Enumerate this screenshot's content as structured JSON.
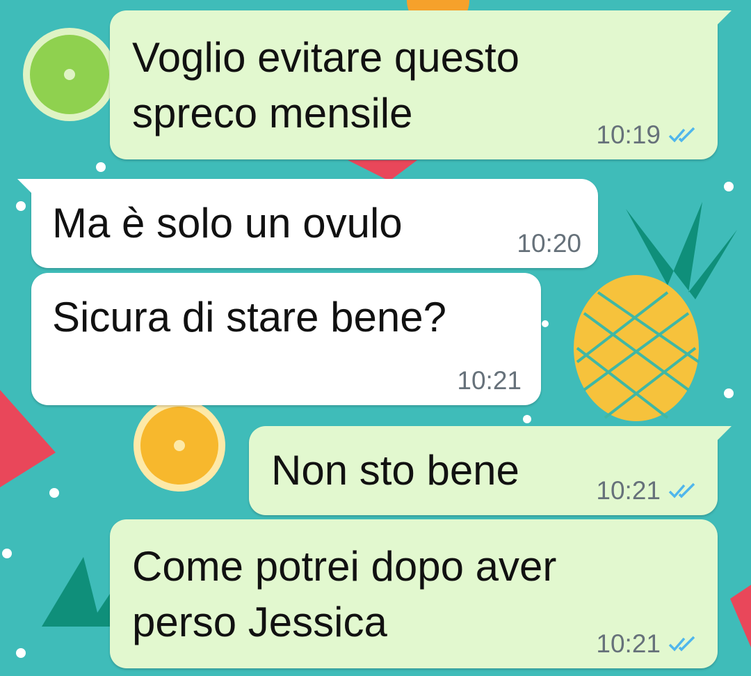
{
  "chat": {
    "messages": [
      {
        "id": "m1",
        "direction": "outgoing",
        "text": "Voglio evitare questo\nspreco mensile",
        "time": "10:19",
        "status": "read"
      },
      {
        "id": "m2",
        "direction": "incoming",
        "text": "Ma è solo un ovulo",
        "time": "10:20"
      },
      {
        "id": "m3",
        "direction": "incoming",
        "text": "Sicura di stare bene?",
        "time": "10:21"
      },
      {
        "id": "m4",
        "direction": "outgoing",
        "text": "Non sto bene",
        "time": "10:21",
        "status": "read"
      },
      {
        "id": "m5",
        "direction": "outgoing",
        "text": "Come potrei dopo aver\nperso Jessica",
        "time": "10:21",
        "status": "read"
      }
    ]
  },
  "colors": {
    "wallpaper": "#3fbcb9",
    "outgoing_bubble": "#e2f8cf",
    "incoming_bubble": "#ffffff",
    "read_check": "#4fb6ec",
    "timestamp": "#66717a"
  },
  "icons": {
    "read_receipt": "double-check-icon"
  }
}
